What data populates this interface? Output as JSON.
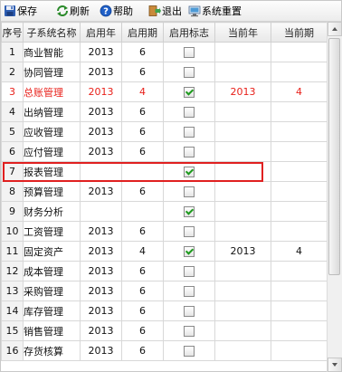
{
  "toolbar": {
    "save": "保存",
    "refresh": "刷新",
    "help": "帮助",
    "exit": "退出",
    "reset": "系统重置"
  },
  "columns": {
    "seq": "序号",
    "name": "子系统名称",
    "start_year": "启用年",
    "start_period": "启用期",
    "flag": "启用标志",
    "current_year": "当前年",
    "current_period": "当前期"
  },
  "rows": [
    {
      "seq": "1",
      "name": "商业智能",
      "start_year": "2013",
      "start_period": "6",
      "flag": false,
      "current_year": "",
      "current_period": ""
    },
    {
      "seq": "2",
      "name": "协同管理",
      "start_year": "2013",
      "start_period": "6",
      "flag": false,
      "current_year": "",
      "current_period": ""
    },
    {
      "seq": "3",
      "name": "总账管理",
      "start_year": "2013",
      "start_period": "4",
      "flag": true,
      "current_year": "2013",
      "current_period": "4"
    },
    {
      "seq": "4",
      "name": "出纳管理",
      "start_year": "2013",
      "start_period": "6",
      "flag": false,
      "current_year": "",
      "current_period": ""
    },
    {
      "seq": "5",
      "name": "应收管理",
      "start_year": "2013",
      "start_period": "6",
      "flag": false,
      "current_year": "",
      "current_period": ""
    },
    {
      "seq": "6",
      "name": "应付管理",
      "start_year": "2013",
      "start_period": "6",
      "flag": false,
      "current_year": "",
      "current_period": ""
    },
    {
      "seq": "7",
      "name": "报表管理",
      "start_year": "",
      "start_period": "",
      "flag": true,
      "current_year": "",
      "current_period": ""
    },
    {
      "seq": "8",
      "name": "预算管理",
      "start_year": "2013",
      "start_period": "6",
      "flag": false,
      "current_year": "",
      "current_period": ""
    },
    {
      "seq": "9",
      "name": "财务分析",
      "start_year": "",
      "start_period": "",
      "flag": true,
      "current_year": "",
      "current_period": ""
    },
    {
      "seq": "10",
      "name": "工资管理",
      "start_year": "2013",
      "start_period": "6",
      "flag": false,
      "current_year": "",
      "current_period": ""
    },
    {
      "seq": "11",
      "name": "固定资产",
      "start_year": "2013",
      "start_period": "4",
      "flag": true,
      "current_year": "2013",
      "current_period": "4"
    },
    {
      "seq": "12",
      "name": "成本管理",
      "start_year": "2013",
      "start_period": "6",
      "flag": false,
      "current_year": "",
      "current_period": ""
    },
    {
      "seq": "13",
      "name": "采购管理",
      "start_year": "2013",
      "start_period": "6",
      "flag": false,
      "current_year": "",
      "current_period": ""
    },
    {
      "seq": "14",
      "name": "库存管理",
      "start_year": "2013",
      "start_period": "6",
      "flag": false,
      "current_year": "",
      "current_period": ""
    },
    {
      "seq": "15",
      "name": "销售管理",
      "start_year": "2013",
      "start_period": "6",
      "flag": false,
      "current_year": "",
      "current_period": ""
    },
    {
      "seq": "16",
      "name": "存货核算",
      "start_year": "2013",
      "start_period": "6",
      "flag": false,
      "current_year": "",
      "current_period": ""
    }
  ],
  "selected_row": "3",
  "highlighted_row": "7",
  "colors": {
    "selected_text": "#e8201a",
    "highlight_border": "#e02020",
    "check": "#1d9a1d"
  },
  "icons": {
    "save": "save-disk-icon",
    "refresh": "refresh-icon",
    "help": "help-icon",
    "exit": "exit-icon",
    "reset": "system-reset-icon"
  }
}
